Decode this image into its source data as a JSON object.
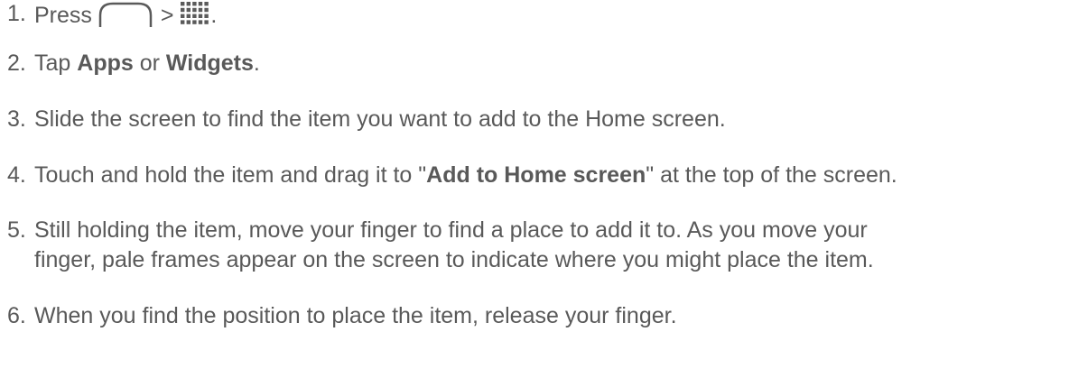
{
  "steps": [
    {
      "number": "1.",
      "press": "Press",
      "separator": ">",
      "end": ".",
      "icons": [
        "home-button-icon",
        "all-apps-grid-icon"
      ]
    },
    {
      "number": "2.",
      "pre": "Tap",
      "bold1": "Apps",
      "mid": "or",
      "bold2": "Widgets",
      "end": "."
    },
    {
      "number": "3.",
      "text": "Slide the screen to find the item you want to add to the Home screen."
    },
    {
      "number": "4.",
      "pre": "Touch and hold the item and drag it to \"",
      "bold": "Add to Home screen",
      "post": "\" at the top of the screen."
    },
    {
      "number": "5.",
      "line1": "Still holding the item, move your finger to find a place to add it to. As you move your",
      "line2": "finger, pale frames appear on the screen to indicate where you might place the item."
    },
    {
      "number": "6.",
      "text": "When you find the position to place the item, release your finger."
    }
  ],
  "colors": {
    "text": "#595959",
    "icon": "#5a5a5a"
  }
}
